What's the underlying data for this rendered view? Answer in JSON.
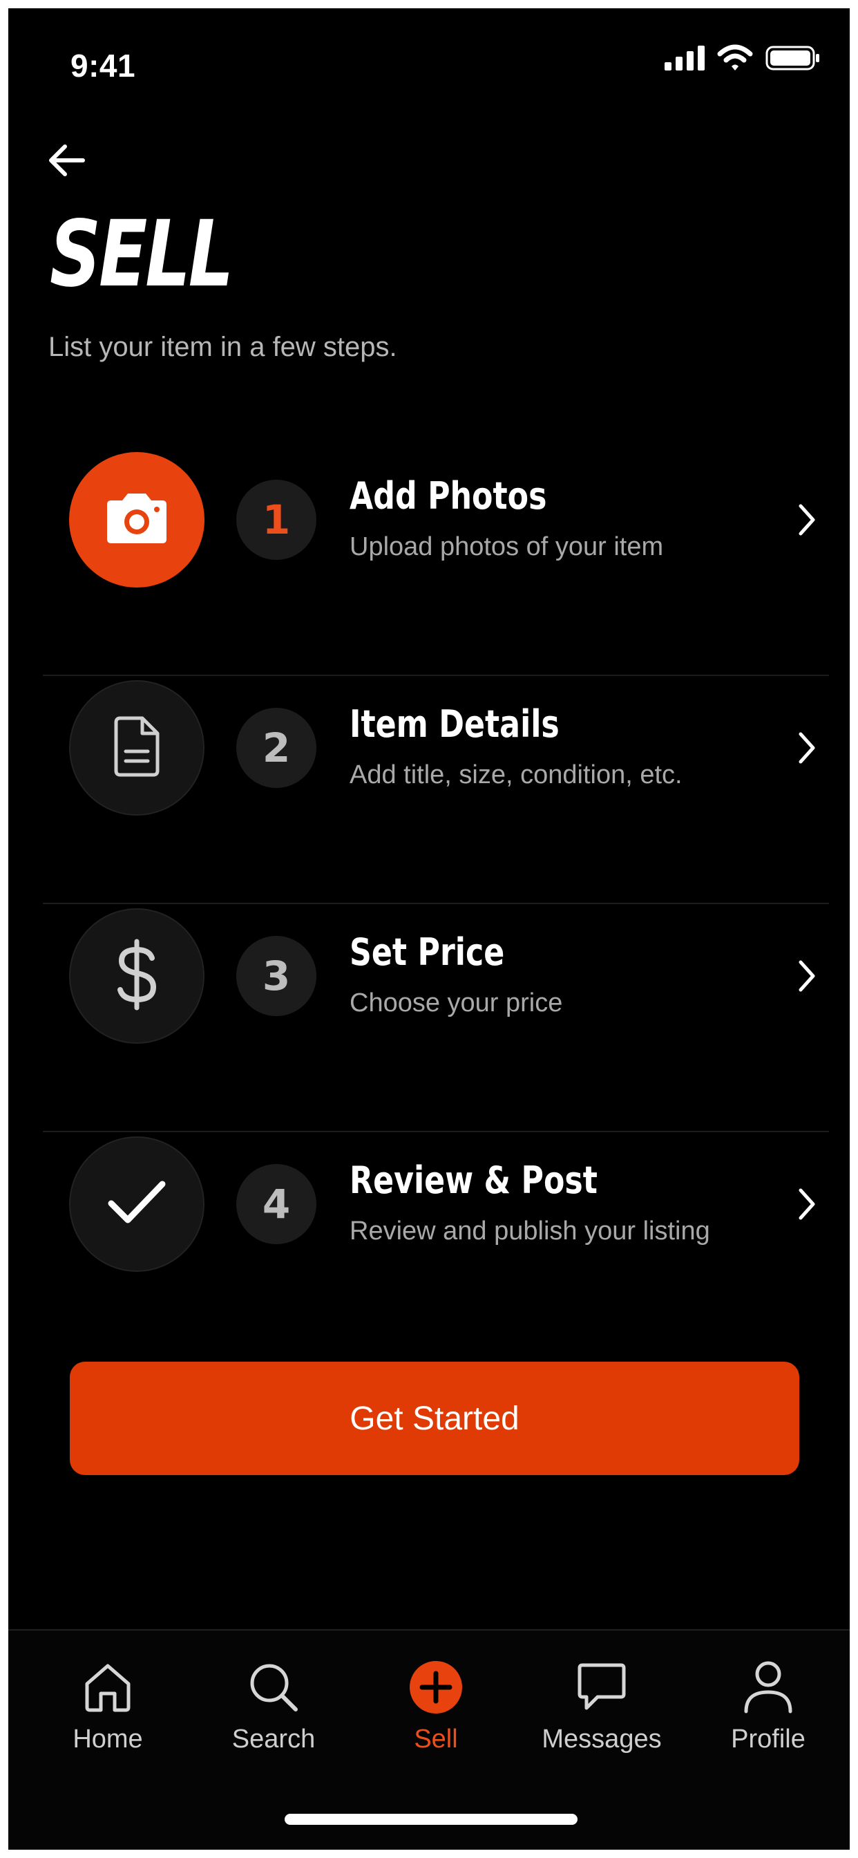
{
  "status_bar": {
    "time": "9:41",
    "icons": [
      "signal-icon",
      "wifi-icon",
      "battery-icon"
    ]
  },
  "header": {
    "back_icon": "arrow-left-icon",
    "title": "SELL",
    "subtitle": "List your item in a few steps."
  },
  "steps": [
    {
      "number": "1",
      "title": "Add Photos",
      "description": "Upload photos of your item",
      "icon": "camera-icon",
      "active": true
    },
    {
      "number": "2",
      "title": "Item Details",
      "description": "Add title, size, condition, etc.",
      "icon": "document-icon",
      "active": false
    },
    {
      "number": "3",
      "title": "Set Price",
      "description": "Choose your price",
      "icon": "dollar-icon",
      "active": false
    },
    {
      "number": "4",
      "title": "Review & Post",
      "description": "Review and publish your listing",
      "icon": "checkmark-icon",
      "active": false
    }
  ],
  "cta": {
    "label": "Get Started"
  },
  "tab_bar": {
    "items": [
      {
        "label": "Home",
        "icon": "home-icon",
        "active": false
      },
      {
        "label": "Search",
        "icon": "search-icon",
        "active": false
      },
      {
        "label": "Sell",
        "icon": "plus-circle-icon",
        "active": true
      },
      {
        "label": "Messages",
        "icon": "chat-bubble-icon",
        "active": false
      },
      {
        "label": "Profile",
        "icon": "person-icon",
        "active": false
      }
    ]
  },
  "colors": {
    "background": "#000000",
    "accent": "#e8420e",
    "text_primary": "#ffffff",
    "text_secondary": "#a9a9a9"
  }
}
